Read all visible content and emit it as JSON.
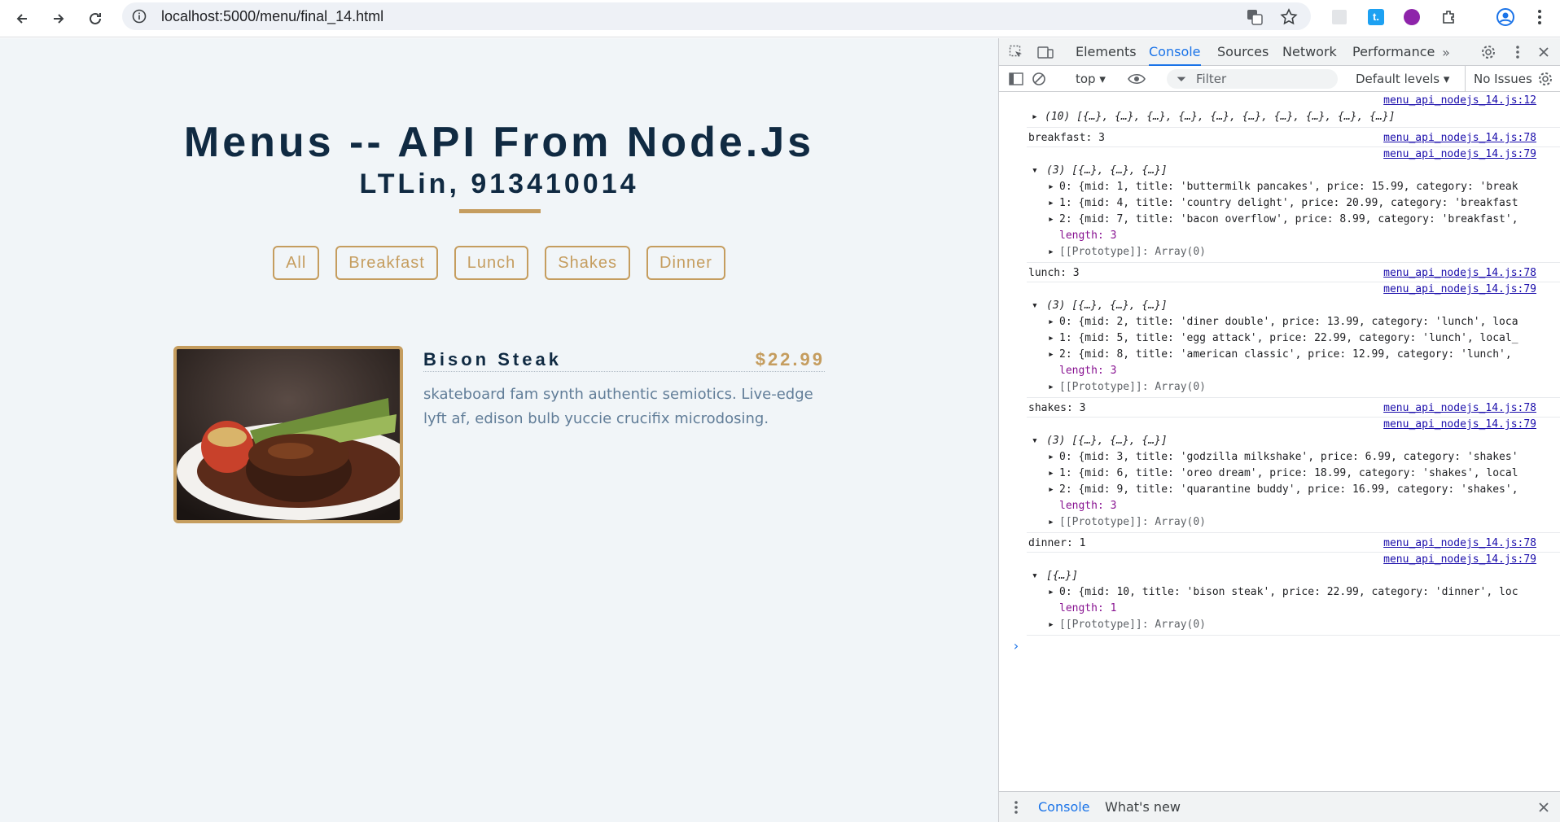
{
  "browser": {
    "url": "localhost:5000/menu/final_14.html"
  },
  "page": {
    "title": "Menus -- API From Node.Js",
    "subtitle": "LTLin, 913410014",
    "filters": [
      "All",
      "Breakfast",
      "Lunch",
      "Shakes",
      "Dinner"
    ],
    "item": {
      "name": "Bison Steak",
      "price": "$22.99",
      "description": "skateboard fam synth authentic semiotics. Live-edge lyft af, edison bulb yuccie crucifix microdosing."
    }
  },
  "devtools": {
    "tabs": [
      "Elements",
      "Console",
      "Sources",
      "Network",
      "Performance"
    ],
    "active_tab": "Console",
    "context": "top",
    "filter_placeholder": "Filter",
    "levels": "Default levels",
    "issues": "No Issues",
    "drawer_tabs": [
      "Console",
      "What's new"
    ],
    "src_a": "menu_api_nodejs_14.js:12",
    "src_b": "menu_api_nodejs_14.js:78",
    "src_c": "menu_api_nodejs_14.js:79",
    "array10": "(10) [{…}, {…}, {…}, {…}, {…}, {…}, {…}, {…}, {…}, {…}]",
    "array3": "(3) [{…}, {…}, {…}]",
    "array1": "[{…}]",
    "length3": "length: 3",
    "length1": "length: 1",
    "proto": "[[Prototype]]: Array(0)",
    "breakfast_label": "breakfast: 3",
    "lunch_label": "lunch: 3",
    "shakes_label": "shakes: 3",
    "dinner_label": "dinner: 1",
    "rows": {
      "b0": "0: {mid: 1, title: 'buttermilk pancakes', price: 15.99, category: 'break",
      "b1": "1: {mid: 4, title: 'country delight', price: 20.99, category: 'breakfast",
      "b2": "2: {mid: 7, title: 'bacon overflow', price: 8.99, category: 'breakfast',",
      "l0": "0: {mid: 2, title: 'diner double', price: 13.99, category: 'lunch', loca",
      "l1": "1: {mid: 5, title: 'egg attack', price: 22.99, category: 'lunch', local_",
      "l2": "2: {mid: 8, title: 'american classic', price: 12.99, category: 'lunch',",
      "s0": "0: {mid: 3, title: 'godzilla milkshake', price: 6.99, category: 'shakes'",
      "s1": "1: {mid: 6, title: 'oreo dream', price: 18.99, category: 'shakes', local",
      "s2": "2: {mid: 9, title: 'quarantine buddy', price: 16.99, category: 'shakes',",
      "d0": "0: {mid: 10, title: 'bison steak', price: 22.99, category: 'dinner', loc"
    }
  }
}
